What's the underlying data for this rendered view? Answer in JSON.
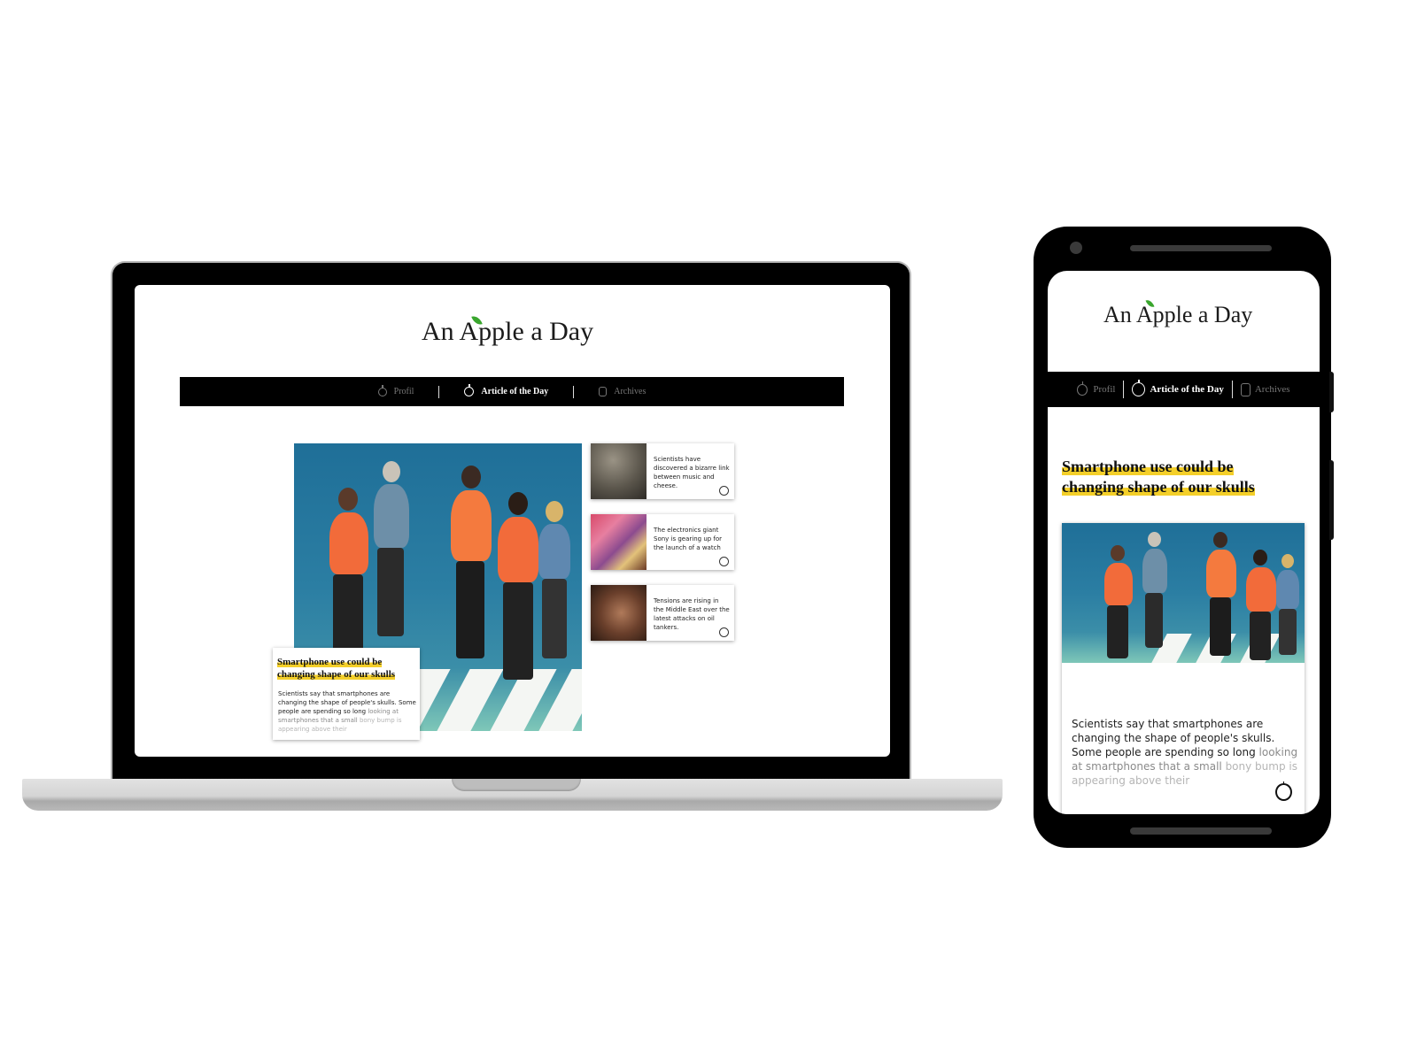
{
  "site": {
    "title_part1": "An ",
    "title_part2": "Apple a Day"
  },
  "nav": {
    "profile": "Profil",
    "article_of_day": "Article of the Day",
    "archives": "Archives"
  },
  "main_article": {
    "headline_line1": "Smartphone use could be",
    "headline_line2": "changing shape of our skulls",
    "excerpt_dark": "Scientists say that smartphones are changing the shape of people's skulls. Some people are spending so long",
    "excerpt_mid": " looking at smartphones that a small",
    "excerpt_light": " bony bump is appearing above their"
  },
  "side_articles": [
    {
      "text": "Scientists have discovered a bizarre link between music and cheese."
    },
    {
      "text": "The electronics giant Sony is gearing up for the launch of a watch"
    },
    {
      "text": "Tensions are rising in the Middle East over the latest attacks on oil tankers."
    }
  ],
  "colors": {
    "highlight": "#f4cf29",
    "leaf": "#3aa62e",
    "nav_bg": "#000000"
  }
}
